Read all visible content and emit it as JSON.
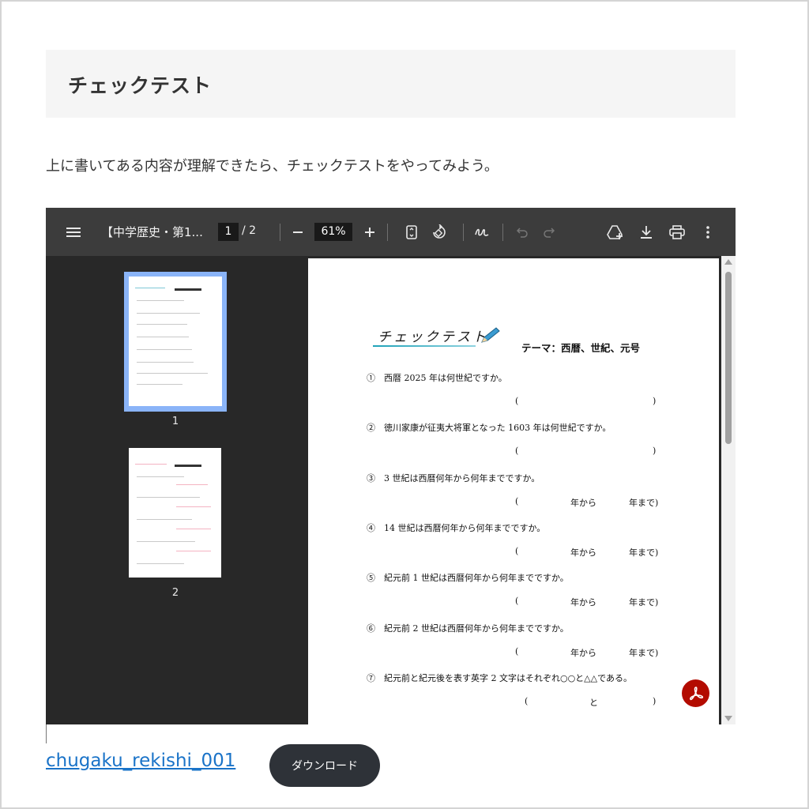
{
  "section": {
    "heading": "チェックテスト"
  },
  "intro_text": "上に書いてある内容が理解できたら、チェックテストをやってみよう。",
  "viewer": {
    "doc_title": "【中学歴史・第1...",
    "current_page": "1",
    "page_total": "/ 2",
    "zoom": "61%",
    "thumbnails": [
      {
        "label": "1"
      },
      {
        "label": "2"
      }
    ]
  },
  "pdf_page": {
    "title": "チェックテスト",
    "theme": "テーマ：西暦、世紀、元号",
    "questions": [
      {
        "text": "①　西暦 2025 年は何世紀ですか。",
        "answer_open": "(",
        "answer_close": ")"
      },
      {
        "text": "②　徳川家康が征夷大将軍となった 1603 年は何世紀ですか。",
        "answer_open": "(",
        "answer_close": ")"
      },
      {
        "text": "③　3 世紀は西暦何年から何年までですか。",
        "answer_open": "(",
        "answer_mid": "年から",
        "answer_close": "年まで)"
      },
      {
        "text": "④　14 世紀は西暦何年から何年までですか。",
        "answer_open": "(",
        "answer_mid": "年から",
        "answer_close": "年まで)"
      },
      {
        "text": "⑤　紀元前 1 世紀は西暦何年から何年までですか。",
        "answer_open": "(",
        "answer_mid": "年から",
        "answer_close": "年まで)"
      },
      {
        "text": "⑥　紀元前 2 世紀は西暦何年から何年までですか。",
        "answer_open": "(",
        "answer_mid": "年から",
        "answer_close": "年まで)"
      },
      {
        "text": "⑦　紀元前と紀元後を表す英字 2 文字はそれぞれ○○と△△である。",
        "answer_open": "(",
        "answer_mid": "と",
        "answer_close": ")"
      }
    ]
  },
  "download": {
    "file_link": "chugaku_rekishi_001",
    "button_label": "ダウンロード"
  },
  "colors": {
    "toolbar": "#3c3c3c",
    "viewer_bg": "#282828",
    "selected_thumb": "#8ab4f8",
    "link": "#1a73c8",
    "acrobat": "#b30b00"
  },
  "icons": [
    "menu-icon",
    "minus-icon",
    "plus-icon",
    "fit-page-icon",
    "rotate-icon",
    "annotate-icon",
    "undo-icon",
    "redo-icon",
    "drive-add-icon",
    "download-icon",
    "print-icon",
    "more-vert-icon",
    "acrobat-icon"
  ]
}
